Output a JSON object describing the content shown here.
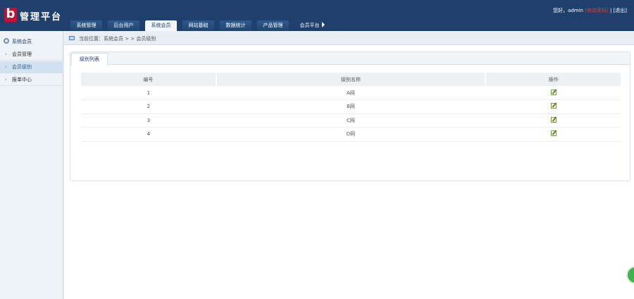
{
  "header": {
    "logo_letter": "b",
    "app_title": "管理平台",
    "greeting": "您好，admin",
    "greeting_link": "[修改密码]",
    "separator": "|",
    "logout": "[退出]"
  },
  "nav": {
    "tabs": [
      {
        "label": "系统管理"
      },
      {
        "label": "后台用户"
      },
      {
        "label": "系统会员"
      },
      {
        "label": "网站基础"
      },
      {
        "label": "数据统计"
      },
      {
        "label": "产品管理"
      }
    ],
    "more_label": "会员平台",
    "active_index": 2
  },
  "sidebar": {
    "title": "系统会员",
    "items": [
      {
        "label": "会员管理"
      },
      {
        "label": "会员级别"
      },
      {
        "label": "报单中心"
      }
    ],
    "active_index": 1
  },
  "breadcrumb": {
    "text": "当前位置：系统会员 > > 会员级别"
  },
  "panel": {
    "tab_label": "级别列表",
    "columns": [
      "编号",
      "级别名称",
      "操作"
    ],
    "rows": [
      {
        "id": "1",
        "name": "A网"
      },
      {
        "id": "2",
        "name": "B网"
      },
      {
        "id": "3",
        "name": "C网"
      },
      {
        "id": "4",
        "name": "D网"
      }
    ]
  },
  "colors": {
    "header_bg": "#1f3f6c",
    "logo_red": "#c8102e",
    "accent_link": "#e53b3b",
    "chat_green": "#3db54a"
  },
  "icons": {
    "sidebar_head": "gear-icon",
    "edit": "edit-icon",
    "breadcrumb": "location-icon",
    "chat": "chat-bubble-icon"
  }
}
